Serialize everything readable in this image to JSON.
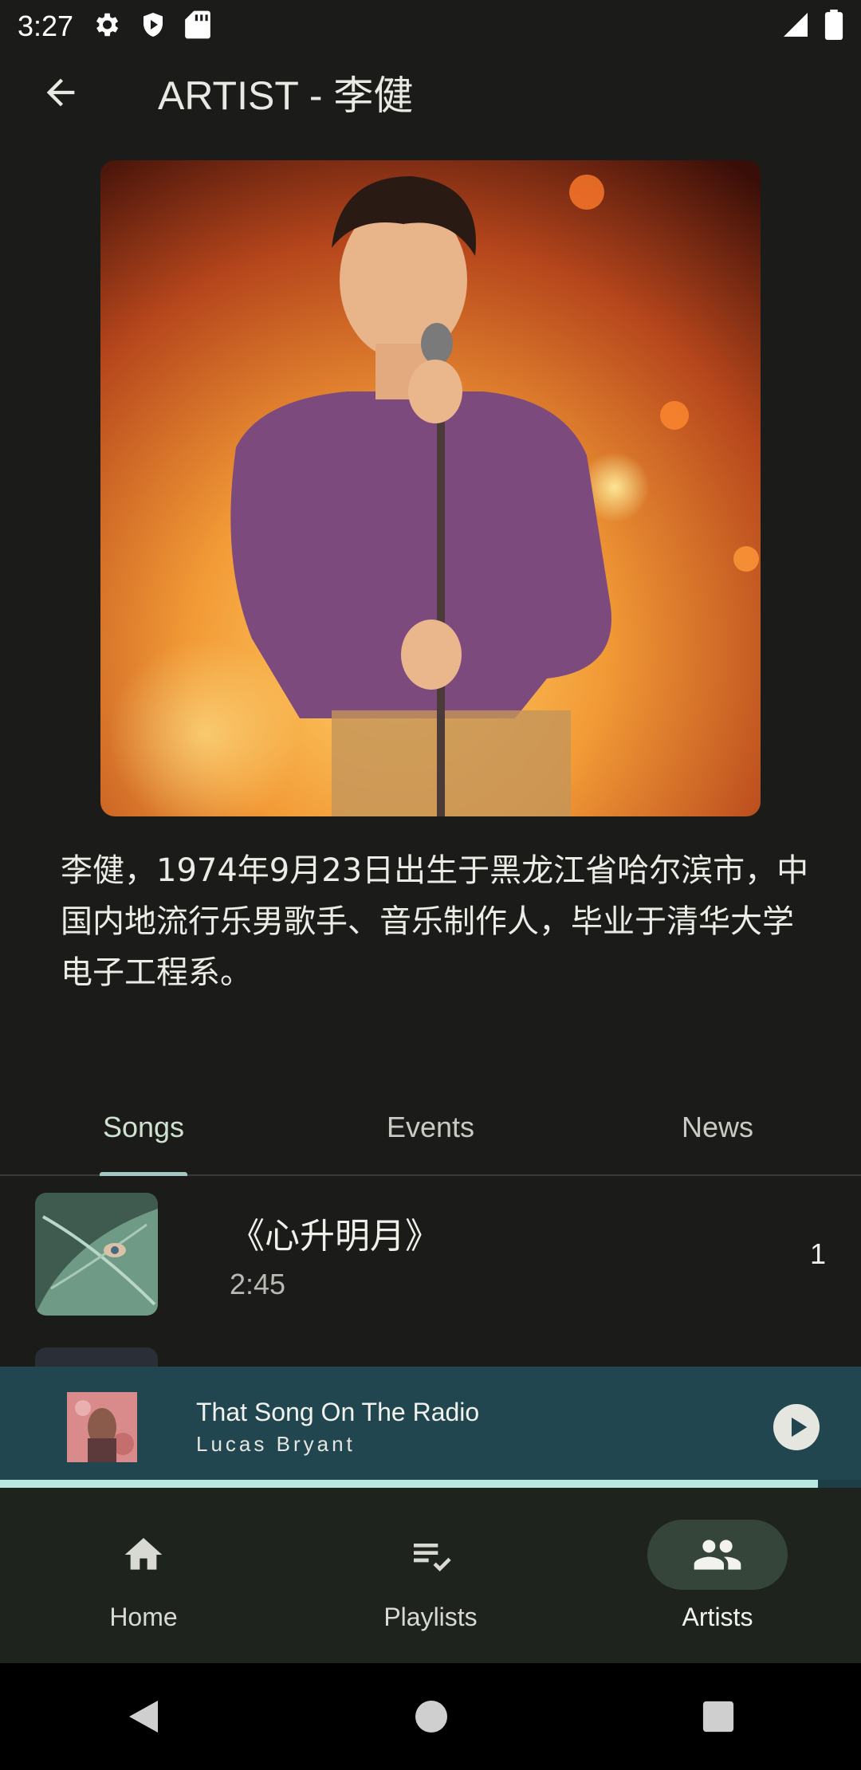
{
  "status": {
    "time": "3:27"
  },
  "header": {
    "title": "ARTIST - 李健"
  },
  "artist": {
    "bio": "李健，1974年9月23日出生于黑龙江省哈尔滨市，中国内地流行乐男歌手、音乐制作人，毕业于清华大学电子工程系。"
  },
  "tabs": [
    {
      "label": "Songs",
      "active": true
    },
    {
      "label": "Events",
      "active": false
    },
    {
      "label": "News",
      "active": false
    }
  ],
  "songs": [
    {
      "title": "《心升明月》",
      "duration": "2:45",
      "index": "1"
    }
  ],
  "now_playing": {
    "title": "That Song On The Radio",
    "artist": "Lucas Bryant",
    "progress": 0.95
  },
  "bottom_nav": [
    {
      "label": "Home",
      "icon": "home-icon"
    },
    {
      "label": "Playlists",
      "icon": "playlist-check-icon"
    },
    {
      "label": "Artists",
      "icon": "people-icon",
      "active": true
    }
  ],
  "colors": {
    "background": "#1b1c1a",
    "mini_player": "#224650",
    "progress": "#b9e8e3",
    "nav_active_pill": "#364539",
    "tab_indicator": "#a6c8c2"
  }
}
